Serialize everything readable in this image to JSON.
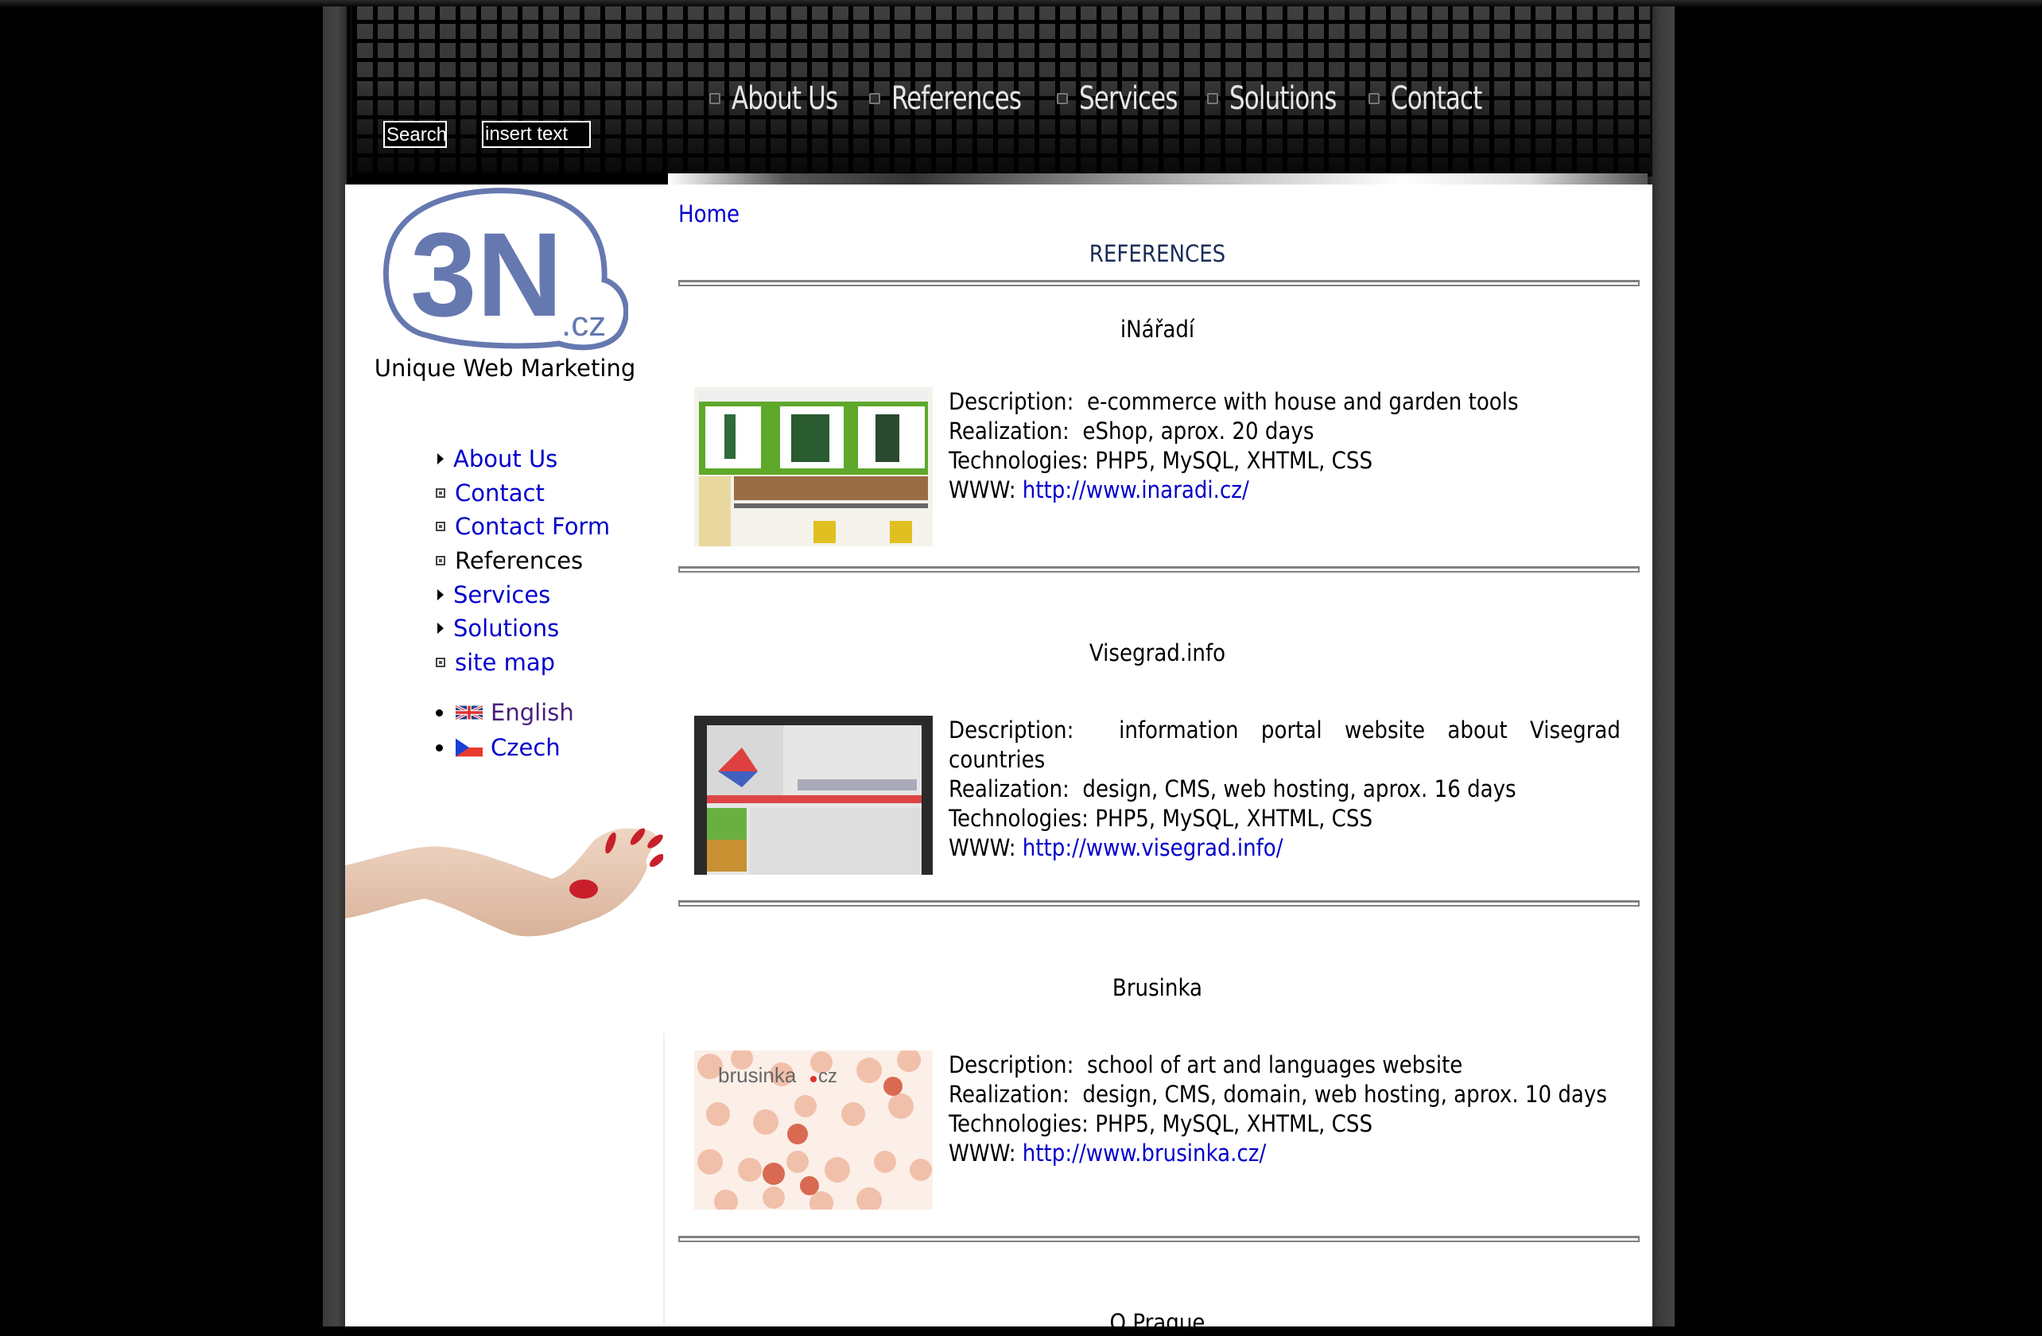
{
  "header": {
    "nav": [
      {
        "label": "About Us"
      },
      {
        "label": "References"
      },
      {
        "label": "Services"
      },
      {
        "label": "Solutions"
      },
      {
        "label": "Contact"
      }
    ],
    "search_button": "Search",
    "search_input_value": "insert text"
  },
  "sidebar": {
    "logo_text": "3N",
    "logo_suffix": ".cz",
    "tagline": "Unique Web Marketing",
    "menu": [
      {
        "label": "About Us",
        "bullet": "triangle",
        "current": false
      },
      {
        "label": "Contact",
        "bullet": "square",
        "current": false
      },
      {
        "label": "Contact Form",
        "bullet": "square",
        "current": false
      },
      {
        "label": "References",
        "bullet": "square",
        "current": true
      },
      {
        "label": "Services",
        "bullet": "triangle",
        "current": false
      },
      {
        "label": "Solutions",
        "bullet": "triangle",
        "current": false
      },
      {
        "label": "site map",
        "bullet": "square",
        "current": false
      }
    ],
    "languages": [
      {
        "label": "English",
        "flag": "uk-flag-icon",
        "color": "#4b1f7a"
      },
      {
        "label": "Czech",
        "flag": "cz-flag-icon",
        "color": "#0000cc"
      }
    ]
  },
  "content": {
    "breadcrumb_home": "Home",
    "page_title": "REFERENCES",
    "references": [
      {
        "title": "iNářadí",
        "description_label": "Description:",
        "description": "e-commerce with house and garden tools",
        "realization_label": "Realization:",
        "realization": "eShop,   aprox. 20 days",
        "technologies_label": "Technologies:",
        "technologies": "PHP5, MySQL, XHTML, CSS",
        "www_label": "WWW:",
        "url": "http://www.inaradi.cz/"
      },
      {
        "title": "Visegrad.info",
        "description_label": "Description:",
        "description": "information portal website about Visegrad countries",
        "realization_label": "Realization:",
        "realization": "design, CMS,  web hosting, aprox. 16 days",
        "technologies_label": "Technologies:",
        "technologies": "PHP5, MySQL, XHTML, CSS",
        "www_label": "WWW:",
        "url": "http://www.visegrad.info/"
      },
      {
        "title": "Brusinka",
        "description_label": "Description:",
        "description": "school of art and languages  website",
        "realization_label": "Realization:",
        "realization": "design, CMS,  domain, web hosting, aprox. 10 days",
        "technologies_label": "Technologies:",
        "technologies": "PHP5, MySQL, XHTML, CSS",
        "www_label": "WWW:",
        "url": "http://www.brusinka.cz/"
      },
      {
        "title": "O Prague"
      }
    ]
  },
  "colors": {
    "link": "#0000cc",
    "logo": "#6678b0",
    "title": "#1a2e5a",
    "separator": "#808080"
  }
}
